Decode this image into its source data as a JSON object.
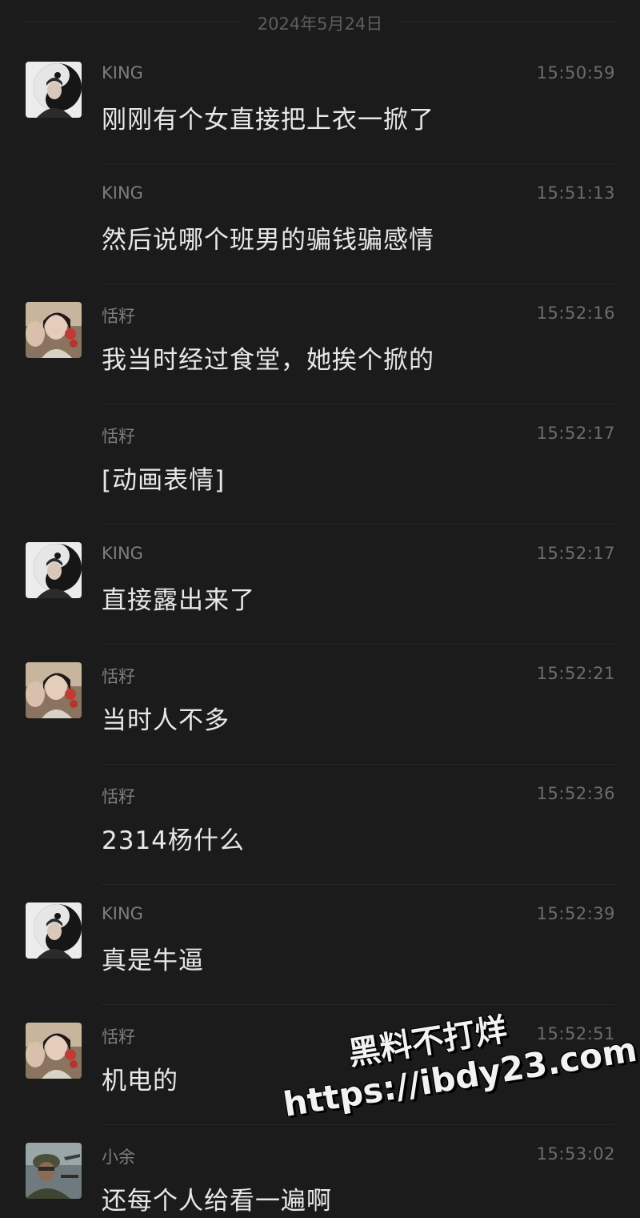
{
  "date_header": "2024年5月24日",
  "messages": [
    {
      "sender": "KING",
      "time": "15:50:59",
      "text": "刚刚有个女直接把上衣一掀了",
      "avatar": "king-avatar"
    },
    {
      "sender": "KING",
      "time": "15:51:13",
      "text": "然后说哪个班男的骗钱骗感情",
      "avatar": null
    },
    {
      "sender": "恬籽",
      "time": "15:52:16",
      "text": "我当时经过食堂，她挨个掀的",
      "avatar": "tianzi-avatar"
    },
    {
      "sender": "恬籽",
      "time": "15:52:17",
      "text": "[动画表情]",
      "avatar": null
    },
    {
      "sender": "KING",
      "time": "15:52:17",
      "text": "直接露出来了",
      "avatar": "king-avatar"
    },
    {
      "sender": "恬籽",
      "time": "15:52:21",
      "text": "当时人不多",
      "avatar": "tianzi-avatar"
    },
    {
      "sender": "恬籽",
      "time": "15:52:36",
      "text": "2314杨什么",
      "avatar": null
    },
    {
      "sender": "KING",
      "time": "15:52:39",
      "text": "真是牛逼",
      "avatar": "king-avatar"
    },
    {
      "sender": "恬籽",
      "time": "15:52:51",
      "text": "机电的",
      "avatar": "tianzi-avatar"
    },
    {
      "sender": "小余",
      "time": "15:53:02",
      "text": "还每个人给看一遍啊",
      "avatar": "xiaoyu-avatar"
    }
  ],
  "watermark": {
    "line1": "黑料不打烊",
    "line2": "https://ibdy23.com"
  }
}
